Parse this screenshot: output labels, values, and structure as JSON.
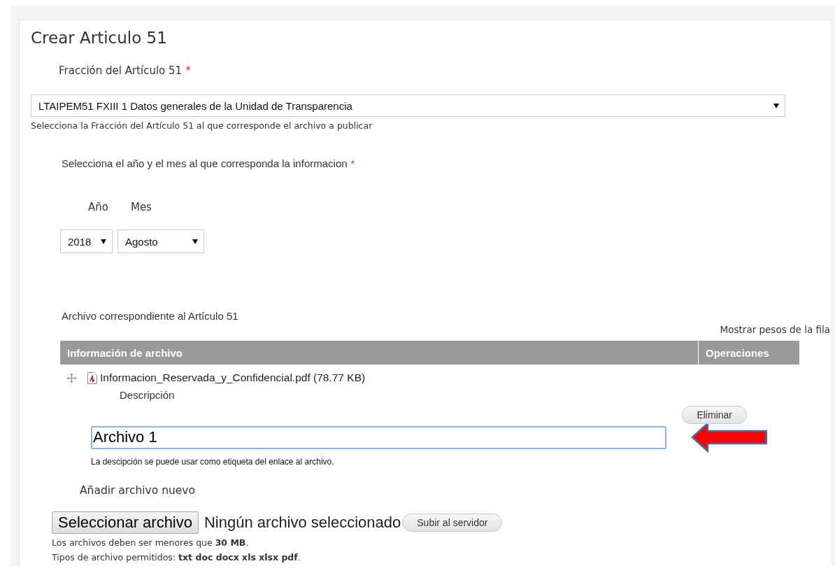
{
  "title": "Crear Articulo 51",
  "fraction": {
    "label": "Fracción del Artículo 51",
    "required_mark": "*",
    "value": "LTAIPEM51 FXIII 1 Datos generales de la Unidad de Transparencia",
    "hint": "Selecciona la Fracción del Artículo 51 al que corresponde el archivo a publicar"
  },
  "period": {
    "label": "Selecciona el año y el mes al que corresponda la informacion",
    "required_mark": "*",
    "year_label": "Año",
    "month_label": "Mes",
    "year_value": "2018",
    "month_value": "Agosto"
  },
  "files": {
    "label": "Archivo correspondiente al Artículo 51",
    "weights_link": "Mostrar pesos de la fila",
    "columns": [
      "Información de archivo",
      "Operaciones"
    ],
    "rows": [
      {
        "filename": "Informacion_Reservada_y_Confidencial.pdf",
        "size": "(78.77 KB)",
        "description_label": "Descripción",
        "description_value": "Archivo 1",
        "description_focused": true,
        "description_hint": "La descipción se puede usar como etiqueta del enlace al archivo.",
        "remove_button": "Eliminar"
      }
    ],
    "add_label": "Añadir archivo nuevo",
    "choose_button": "Seleccionar archivo",
    "no_file": "Ningún archivo seleccionado",
    "upload_button": "Subir al servidor",
    "limits": [
      "Los archivos deben ser menores que **30 MB**.",
      "Tipos de archivo permitidos: **txt doc docx xls xlsx pdf**."
    ]
  }
}
